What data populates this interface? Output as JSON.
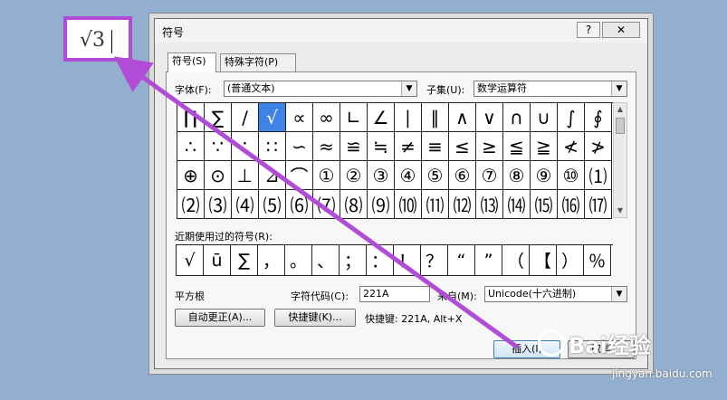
{
  "document": {
    "inserted_text": "√3"
  },
  "dialog": {
    "title": "符号",
    "help_label": "?",
    "close_label": "✕",
    "tabs": [
      {
        "label": "符号(S)"
      },
      {
        "label": "特殊字符(P)"
      }
    ],
    "font_label": "字体(F):",
    "font_value": "(普通文本)",
    "subset_label": "子集(U):",
    "subset_value": "数学运算符",
    "symbols": [
      "∏",
      "∑",
      "∕",
      "√",
      "∝",
      "∞",
      "∟",
      "∠",
      "∣",
      "∥",
      "∧",
      "∨",
      "∩",
      "∪",
      "∫",
      "∮",
      "∴",
      "∵",
      "∶",
      "∷",
      "∽",
      "≈",
      "≌",
      "≒",
      "≠",
      "≡",
      "≤",
      "≥",
      "≦",
      "≧",
      "≮",
      "≯",
      "⊕",
      "⊙",
      "⊥",
      "⊿",
      "⌒",
      "①",
      "②",
      "③",
      "④",
      "⑤",
      "⑥",
      "⑦",
      "⑧",
      "⑨",
      "⑩",
      "⑴",
      "⑵",
      "⑶",
      "⑷",
      "⑸",
      "⑹",
      "⑺",
      "⑻",
      "⑼",
      "⑽",
      "⑾",
      "⑿",
      "⒀",
      "⒁",
      "⒂",
      "⒃",
      "⒄"
    ],
    "selected_symbol": "√",
    "recent_label": "近期使用过的符号(R):",
    "recent_symbols": [
      "√",
      "ū",
      "∑",
      "，",
      "。",
      "、",
      "；",
      "：",
      "！",
      "？",
      "“",
      "”",
      "（",
      "【",
      "）",
      "％"
    ],
    "char_name": "平方根",
    "char_code_label": "字符代码(C):",
    "char_code_value": "221A",
    "from_label": "来自(M):",
    "from_value": "Unicode(十六进制)",
    "autocorrect_button": "自动更正(A)...",
    "shortcut_button": "快捷键(K)...",
    "shortcut_text": "快捷键: 221A, Alt+X",
    "insert_button": "插入(I)",
    "cancel_button": "取消"
  },
  "watermark": {
    "brand": "Bai经验",
    "url": "jingyan.baidu.com"
  },
  "colors": {
    "background": "#93afd0",
    "highlight_border": "#b04cd6",
    "selection": "#3f83e6",
    "arrow": "#b04cd6"
  }
}
